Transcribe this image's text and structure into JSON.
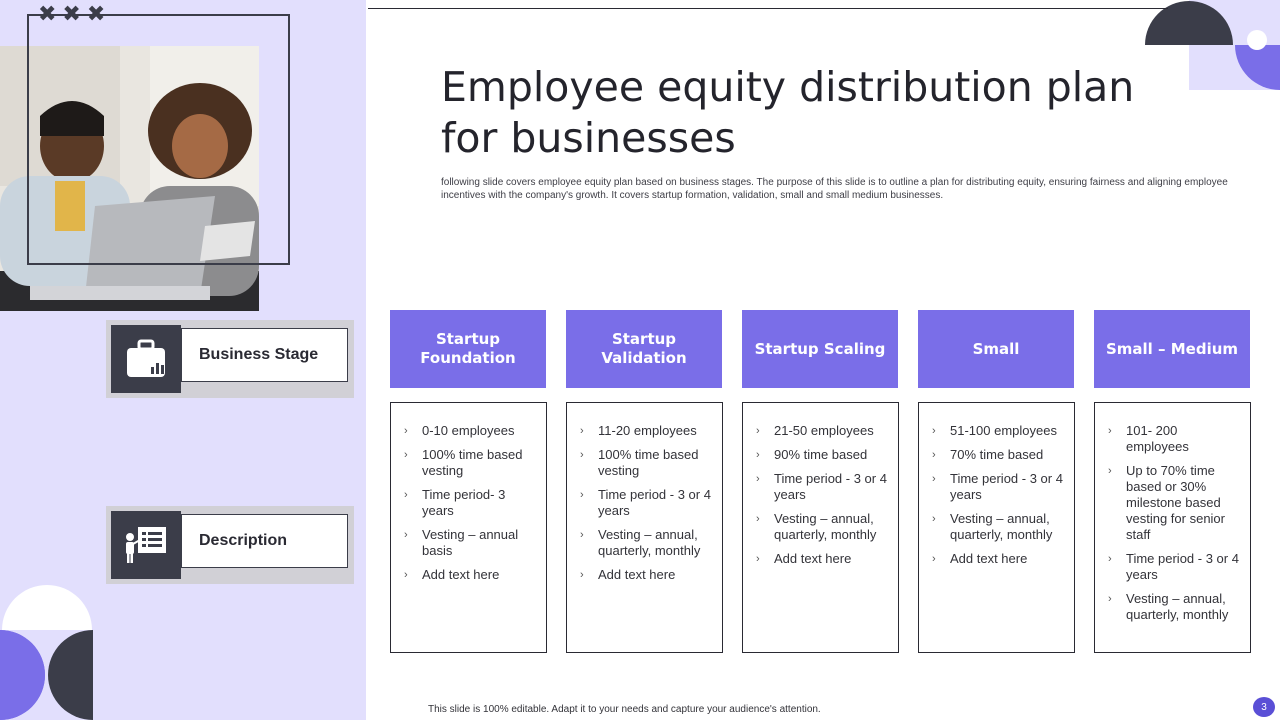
{
  "slide": {
    "title": "Employee equity distribution plan for businesses",
    "subtitle": "following slide covers employee equity plan based on business stages. The purpose of this slide is to outline a plan for distributing equity, ensuring fairness and aligning employee incentives with the company's growth. It covers startup formation, validation, small and small medium businesses.",
    "footer": "This slide is 100% editable. Adapt it to your needs and capture your audience's attention.",
    "page_number": "3"
  },
  "sidebar": {
    "business_stage_label": "Business Stage",
    "description_label": "Description",
    "icons": [
      "briefcase-chart-icon",
      "presenter-board-icon"
    ]
  },
  "columns": [
    {
      "header": "Startup Foundation",
      "items": [
        "0-10 employees",
        "100% time based vesting",
        "Time period- 3 years",
        "Vesting – annual basis",
        "Add text here"
      ]
    },
    {
      "header": "Startup Validation",
      "items": [
        "11-20 employees",
        "100% time based vesting",
        "Time period - 3 or 4 years",
        "Vesting – annual, quarterly, monthly",
        "Add text here"
      ]
    },
    {
      "header": "Startup Scaling",
      "items": [
        "21-50 employees",
        "90% time based",
        "Time period - 3 or 4 years",
        "Vesting – annual, quarterly, monthly",
        "Add text here"
      ]
    },
    {
      "header": "Small",
      "items": [
        "51-100 employees",
        "70% time based",
        "Time period - 3 or 4 years",
        "Vesting – annual, quarterly, monthly",
        "Add text here"
      ]
    },
    {
      "header": "Small – Medium",
      "items": [
        "101- 200 employees",
        "Up to 70% time based or 30% milestone based vesting for senior staff",
        "Time period - 3 or 4 years",
        "Vesting – annual, quarterly, monthly"
      ]
    }
  ],
  "colors": {
    "accent": "#7a6ee8",
    "panel": "#e2dffd",
    "dark": "#3b3d49"
  }
}
